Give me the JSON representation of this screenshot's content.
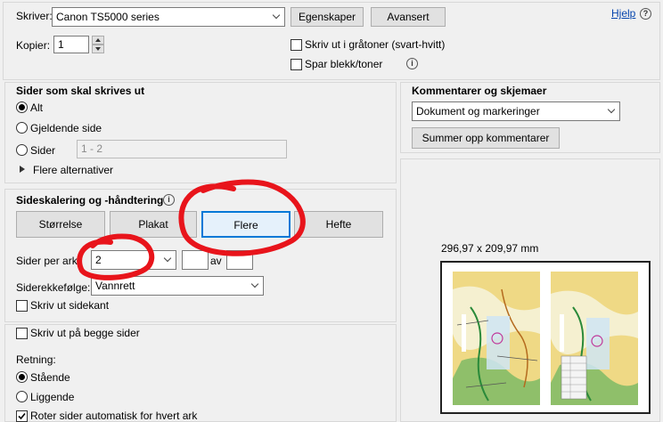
{
  "printer": {
    "label": "Skriver:",
    "value": "Canon TS5000 series",
    "properties_button": "Egenskaper",
    "advanced_button": "Avansert",
    "help_link": "Hjelp",
    "help_icon": "?",
    "copies_label": "Kopier:",
    "copies_value": "1",
    "grayscale_label": "Skriv ut i gråtoner (svart-hvitt)",
    "save_ink_label": "Spar blekk/toner",
    "info_icon": "i"
  },
  "pages_to_print": {
    "title": "Sider som skal skrives ut",
    "all_label": "Alt",
    "current_label": "Gjeldende side",
    "pages_label": "Sider",
    "pages_value": "1 - 2",
    "more_options_label": "Flere alternativer"
  },
  "comments": {
    "title": "Kommentarer og skjemaer",
    "dropdown_value": "Dokument og markeringer",
    "summarize_button": "Summer opp kommentarer"
  },
  "scaling": {
    "title": "Sideskalering og -håndtering",
    "info_icon": "i",
    "size_button": "Størrelse",
    "poster_button": "Plakat",
    "multiple_button": "Flere",
    "booklet_button": "Hefte",
    "pages_per_sheet_label": "Sider per ark:",
    "pages_per_sheet_value": "2",
    "by_label": "av",
    "order_label": "Siderekkefølge:",
    "order_value": "Vannrett",
    "print_border_label": "Skriv ut sidekant"
  },
  "duplex": {
    "both_sides_label": "Skriv ut på begge sider",
    "orientation_label": "Retning:",
    "portrait_label": "Stående",
    "landscape_label": "Liggende",
    "auto_rotate_label": "Roter sider automatisk for hvert ark"
  },
  "preview": {
    "size_text": "296,97 x 209,97 mm"
  },
  "colors": {
    "annotation_red": "#e8141b",
    "selected_border": "#0078d7"
  }
}
